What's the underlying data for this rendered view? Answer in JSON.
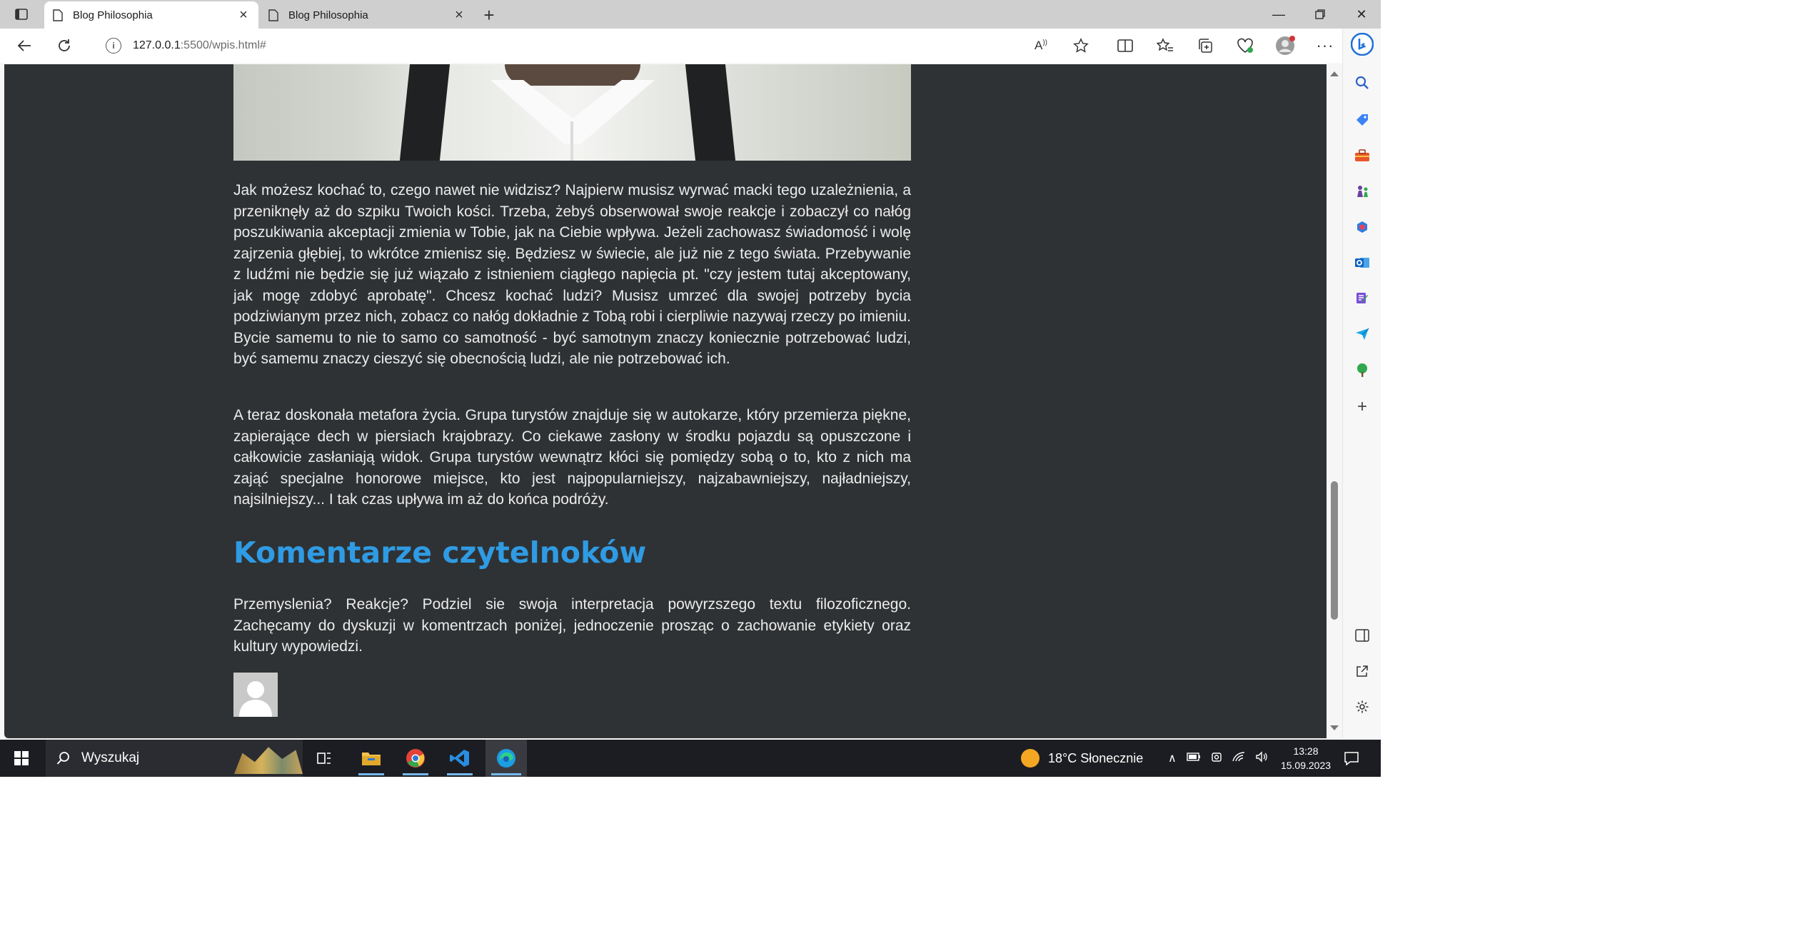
{
  "browser": {
    "tabs": [
      {
        "title": "Blog Philosophia",
        "active": true
      },
      {
        "title": "Blog Philosophia",
        "active": false
      }
    ],
    "address": {
      "host": "127.0.0.1",
      "path": ":5500/wpis.html#"
    }
  },
  "article": {
    "paragraphs": [
      "Jak możesz kochać to, czego nawet nie widzisz? Najpierw musisz wyrwać macki tego uzależnienia, a przeniknęły aż do szpiku Twoich kości. Trzeba, żebyś obserwował swoje reakcje i zobaczył co nałóg poszukiwania akceptacji zmienia w Tobie, jak na Ciebie wpływa. Jeżeli zachowasz świadomość i wolę zajrzenia głębiej, to wkrótce zmienisz się. Będziesz w świecie, ale już nie z tego świata. Przebywanie z ludźmi nie będzie się już wiązało z istnieniem ciągłego napięcia pt. \"czy jestem tutaj akceptowany, jak mogę zdobyć aprobatę\". Chcesz kochać ludzi? Musisz umrzeć dla swojej potrzeby bycia podziwianym przez nich, zobacz co nałóg dokładnie z Tobą robi i cierpliwie nazywaj rzeczy po imieniu. Bycie samemu to nie to samo co samotność - być samotnym znaczy koniecznie potrzebować ludzi, być samemu znaczy cieszyć się obecnością ludzi, ale nie potrzebować ich.",
      "A teraz doskonała metafora życia. Grupa turystów znajduje się w autokarze, który przemierza piękne, zapierające dech w piersiach krajobrazy. Co ciekawe zasłony w środku pojazdu są opuszczone i całkowicie zasłaniają widok. Grupa turystów wewnątrz kłóci się pomiędzy sobą o to, kto z nich ma zająć specjalne honorowe miejsce, kto jest najpopularniejszy, najzabawniejszy, najładniejszy, najsilniejszy... I tak czas upływa im aż do końca podróży."
    ]
  },
  "comments": {
    "heading": "Komentarze czytelnoków",
    "intro": "Przemyslenia? Reakcje? Podziel sie swoja interpretacja powyrzszego textu filozoficznego. Zachęcamy do dyskuzji w komentrzach poniżej, jednoczenie prosząc o zachowanie etykiety oraz kultury wypowiedzi."
  },
  "taskbar": {
    "search_placeholder": "Wyszukaj",
    "weather": "18°C  Słonecznie",
    "time": "13:28",
    "date": "15.09.2023"
  },
  "colors": {
    "page_bg": "#2f3234",
    "heading": "#2f9be4",
    "text": "#ececec"
  }
}
